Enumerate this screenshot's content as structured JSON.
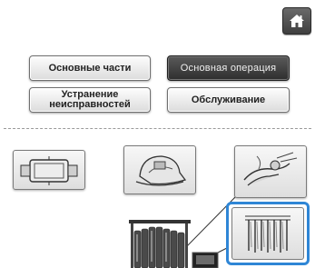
{
  "header": {
    "home_icon": "home-icon"
  },
  "menu": {
    "basic_parts": "Основные части",
    "basic_operation": "Основная операция",
    "troubleshooting_line1": "Устранение",
    "troubleshooting_line2": "неисправностей",
    "maintenance": "Обслуживание"
  },
  "thumbnails": [
    {
      "icon": "embroidery-frame-icon"
    },
    {
      "icon": "cap-frame-icon"
    },
    {
      "icon": "threading-icon"
    },
    {
      "icon": "needle-bar-threads-icon",
      "selected": true
    }
  ],
  "colors": {
    "selected_border": "#2f86d6",
    "active_button": "#3a3a3a",
    "home_button": "#4d4d4d"
  }
}
